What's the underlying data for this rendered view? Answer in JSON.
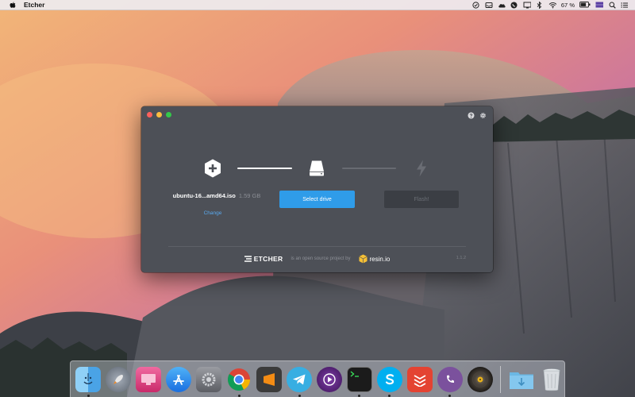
{
  "menubar": {
    "app_name": "Etcher",
    "battery_percent": "67 %",
    "status_icons": [
      "checkmark-circle-icon",
      "inbox-icon",
      "cloud-icon",
      "viber-icon",
      "display-icon",
      "bluetooth-icon",
      "wifi-icon",
      "battery-icon",
      "flag-icon",
      "search-icon",
      "menu-list-icon"
    ]
  },
  "window": {
    "steps": {
      "image": {
        "filename": "ubuntu-16...amd64.iso",
        "size": "1.59 GB",
        "change_label": "Change"
      },
      "drive": {
        "button_label": "Select drive"
      },
      "flash": {
        "button_label": "Flash!"
      }
    },
    "footer": {
      "brand": "ETCHER",
      "tagline": "is an open source project by",
      "company": "resin.io",
      "version": "1.1.2"
    },
    "colors": {
      "background": "#4d5057",
      "accent": "#2f9ce9",
      "link": "#5aa9ee",
      "disabled": "#3b3e44"
    }
  },
  "dock": {
    "apps": [
      {
        "name": "finder",
        "color": "#5fb4ee",
        "running": true
      },
      {
        "name": "launchpad",
        "color": "#7f8a99",
        "running": false
      },
      {
        "name": "cleanmymac",
        "color": "#e24a83",
        "running": false
      },
      {
        "name": "app-store",
        "color": "#2c8ff2",
        "running": false
      },
      {
        "name": "system-preferences",
        "color": "#7d7f85",
        "running": false
      },
      {
        "name": "chrome",
        "color": "#e8e8e8",
        "running": true
      },
      {
        "name": "sublime-text",
        "color": "#f48c14",
        "running": false
      },
      {
        "name": "telegram",
        "color": "#36a6de",
        "running": true
      },
      {
        "name": "screencast",
        "color": "#5c2a78",
        "running": false
      },
      {
        "name": "terminal",
        "color": "#1a1a1a",
        "running": true
      },
      {
        "name": "skype",
        "color": "#0aa5e8",
        "running": true
      },
      {
        "name": "todoist",
        "color": "#e0453a",
        "running": false
      },
      {
        "name": "viber",
        "color": "#7b519d",
        "running": true
      },
      {
        "name": "vox",
        "color": "#2d2a26",
        "running": false
      },
      {
        "name": "downloads",
        "color": "#58a8d8",
        "running": false
      },
      {
        "name": "trash",
        "color": "#d8dce0",
        "running": false
      }
    ]
  }
}
